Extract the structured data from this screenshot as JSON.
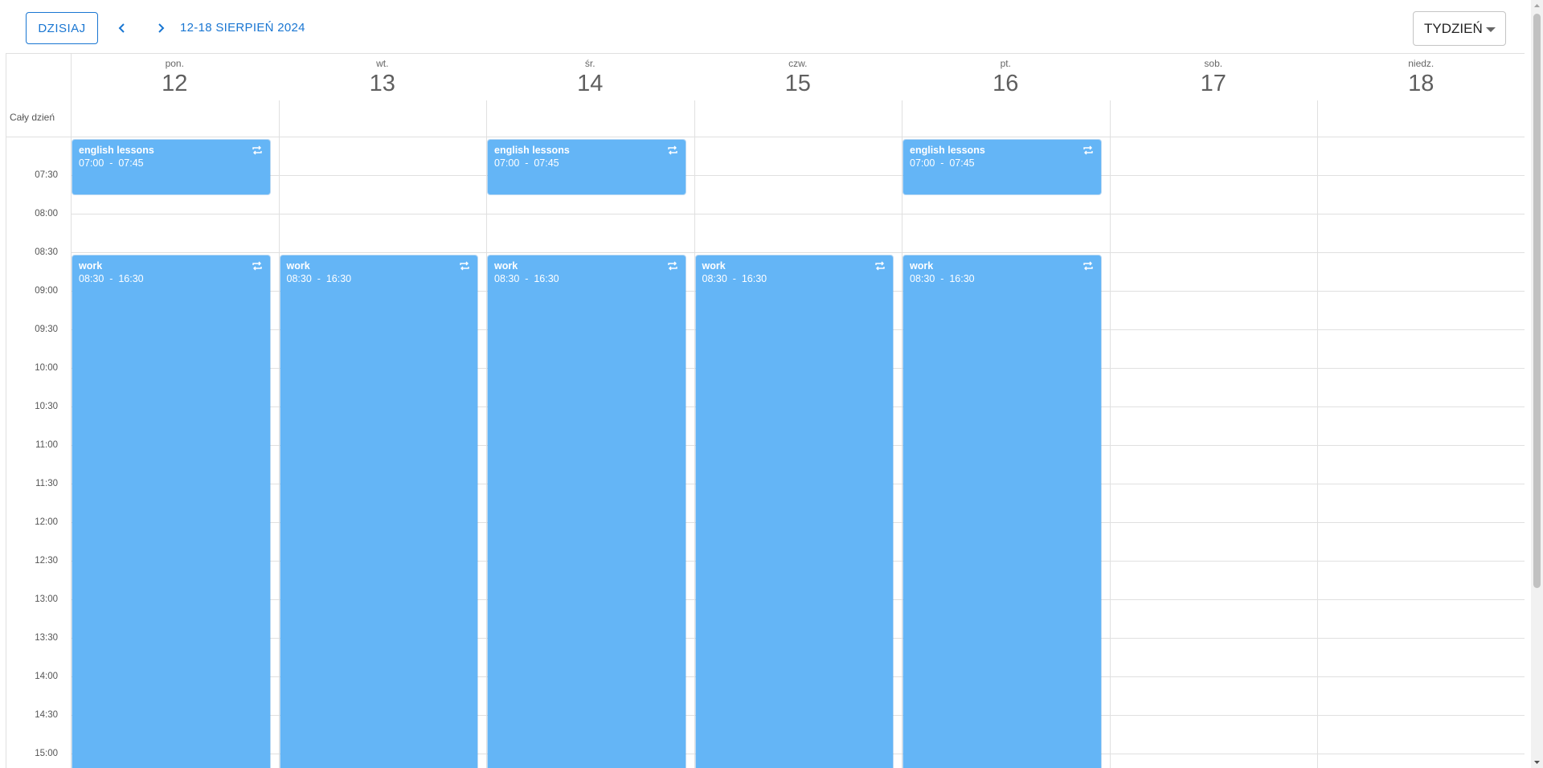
{
  "toolbar": {
    "today_label": "DZISIAJ",
    "range_label": "12-18 SIERPIEŃ 2024",
    "view_label": "TYDZIEŃ"
  },
  "allday_label": "Cały dzień",
  "days": [
    {
      "name": "pon.",
      "num": "12"
    },
    {
      "name": "wt.",
      "num": "13"
    },
    {
      "name": "śr.",
      "num": "14"
    },
    {
      "name": "czw.",
      "num": "15"
    },
    {
      "name": "pt.",
      "num": "16"
    },
    {
      "name": "sob.",
      "num": "17"
    },
    {
      "name": "niedz.",
      "num": "18"
    }
  ],
  "time_labels": [
    "07:30",
    "08:00",
    "08:30",
    "09:00",
    "09:30",
    "10:00",
    "10:30",
    "11:00",
    "11:30",
    "12:00",
    "12:30",
    "13:00",
    "13:30",
    "14:00",
    "14:30",
    "15:00"
  ],
  "events": [
    {
      "day": 0,
      "title": "english lessons",
      "start": "07:00",
      "end": "07:45",
      "recurring_icon": "repeat-icon"
    },
    {
      "day": 2,
      "title": "english lessons",
      "start": "07:00",
      "end": "07:45",
      "recurring_icon": "repeat-icon"
    },
    {
      "day": 4,
      "title": "english lessons",
      "start": "07:00",
      "end": "07:45",
      "recurring_icon": "repeat-icon"
    },
    {
      "day": 0,
      "title": "work",
      "start": "08:30",
      "end": "16:30",
      "recurring_icon": "repeat-icon"
    },
    {
      "day": 1,
      "title": "work",
      "start": "08:30",
      "end": "16:30",
      "recurring_icon": "repeat-icon"
    },
    {
      "day": 2,
      "title": "work",
      "start": "08:30",
      "end": "16:30",
      "recurring_icon": "repeat-icon"
    },
    {
      "day": 3,
      "title": "work",
      "start": "08:30",
      "end": "16:30",
      "recurring_icon": "repeat-icon"
    },
    {
      "day": 4,
      "title": "work",
      "start": "08:30",
      "end": "16:30",
      "recurring_icon": "repeat-icon"
    }
  ],
  "colors": {
    "accent": "#1976d2",
    "event": "#64b5f6",
    "grid": "#e0e0e0"
  },
  "icons": {
    "prev": "chevron-left-icon",
    "next": "chevron-right-icon",
    "dropdown": "caret-down-icon",
    "recurring": "repeat-icon"
  }
}
